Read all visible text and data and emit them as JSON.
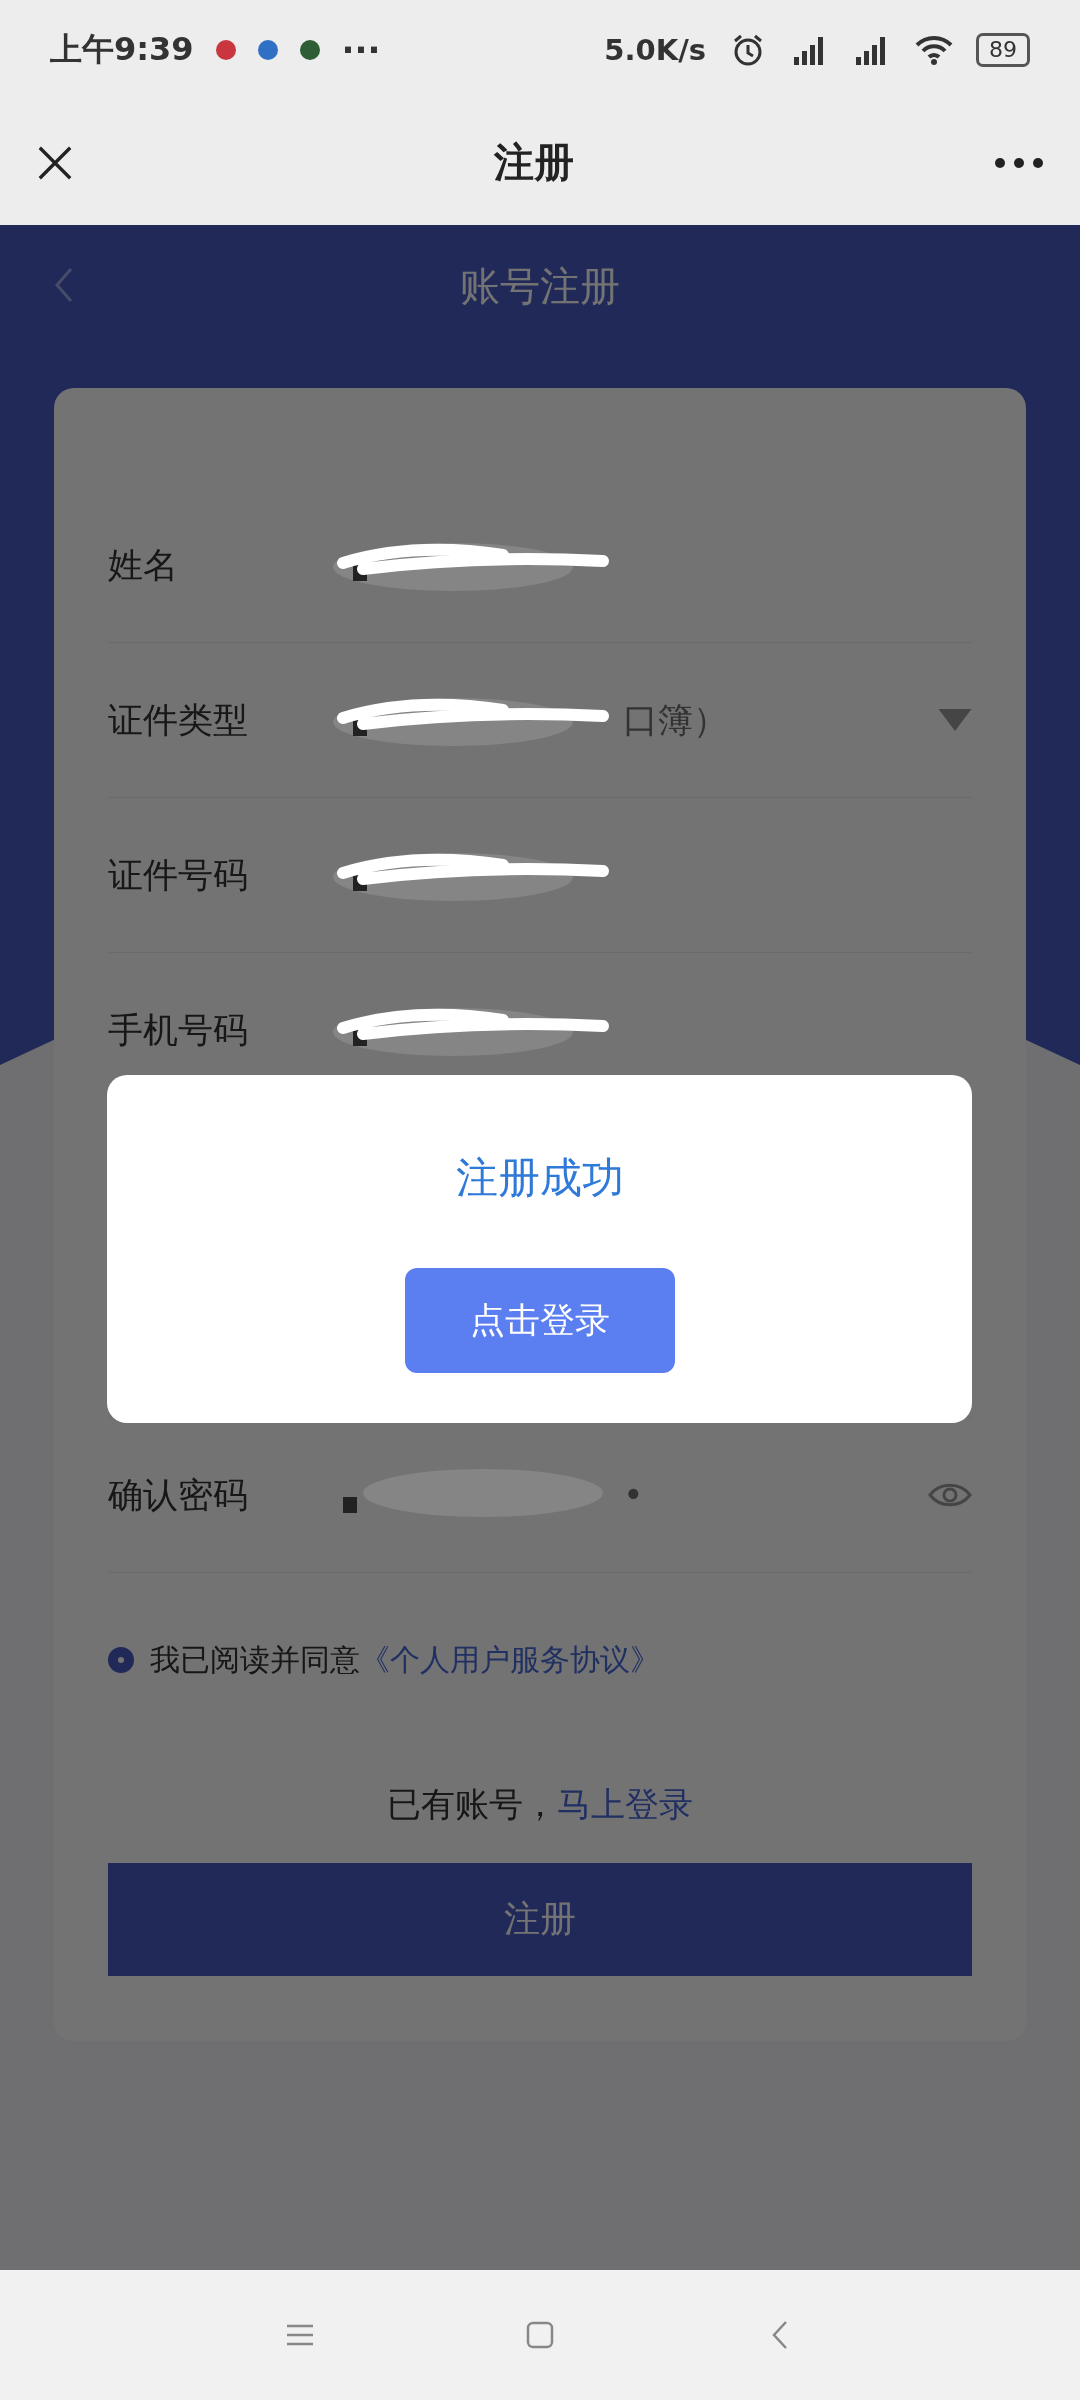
{
  "status_bar": {
    "time": "上午9:39",
    "notifications": [
      {
        "color": "#c9363f"
      },
      {
        "color": "#2f6fc4"
      },
      {
        "color": "#2e5e36"
      }
    ],
    "more": "···",
    "speed": "5.0K/s",
    "battery": "89"
  },
  "nav_bar": {
    "title": "注册"
  },
  "page": {
    "title": "账号注册"
  },
  "form": {
    "fields_above": [
      {
        "label": "姓名",
        "kind": "text",
        "redacted": true
      },
      {
        "label": "证件类型",
        "kind": "select",
        "value": "口簿）",
        "redacted": true
      },
      {
        "label": "证件号码",
        "kind": "text",
        "redacted": true
      },
      {
        "label": "手机号码",
        "kind": "text",
        "redacted": true
      }
    ],
    "fields_below": [
      {
        "label": "确认密码",
        "kind": "password",
        "value": "•",
        "redacted": true
      }
    ],
    "agreement": {
      "checked": true,
      "text": "我已阅读并同意",
      "link": "《个人用户服务协议》"
    },
    "login_prompt": {
      "text": "已有账号，",
      "link": "马上登录"
    },
    "submit": "注册"
  },
  "dialog": {
    "title": "注册成功",
    "button": "点击登录"
  }
}
